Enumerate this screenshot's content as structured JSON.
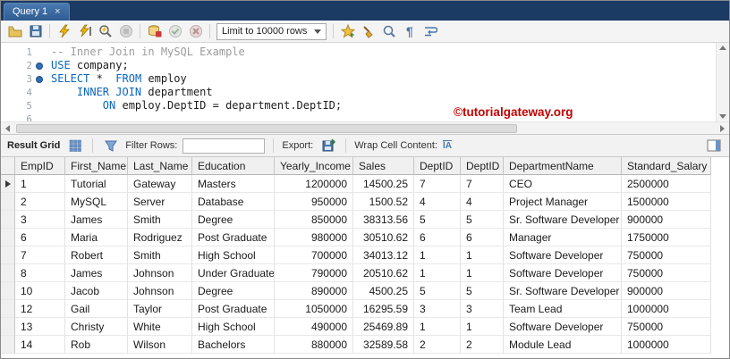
{
  "window": {
    "tab_title": "Query 1",
    "close_glyph": "×"
  },
  "toolbar": {
    "limit_dropdown": "Limit to 10000 rows",
    "pilcrow_glyph": "¶"
  },
  "editor": {
    "lines": [
      {
        "n": "1",
        "dot": false,
        "tokens": [
          {
            "t": "-- Inner Join in MySQL Example",
            "c": "comment"
          }
        ]
      },
      {
        "n": "2",
        "dot": true,
        "tokens": [
          {
            "t": "USE",
            "c": "kw"
          },
          {
            "t": " company;",
            "c": "pl"
          }
        ]
      },
      {
        "n": "3",
        "dot": true,
        "tokens": [
          {
            "t": "SELECT",
            "c": "kw"
          },
          {
            "t": " * ",
            "c": "pl"
          },
          {
            "t": " FROM",
            "c": "kw"
          },
          {
            "t": " employ",
            "c": "pl"
          }
        ]
      },
      {
        "n": "4",
        "dot": false,
        "tokens": [
          {
            "t": "    ",
            "c": "pl"
          },
          {
            "t": "INNER JOIN",
            "c": "kw"
          },
          {
            "t": " department",
            "c": "pl"
          }
        ]
      },
      {
        "n": "5",
        "dot": false,
        "tokens": [
          {
            "t": "        ",
            "c": "pl"
          },
          {
            "t": "ON",
            "c": "kw"
          },
          {
            "t": " employ.DeptID = department.DeptID;",
            "c": "pl"
          }
        ]
      },
      {
        "n": "6",
        "dot": false,
        "tokens": []
      }
    ]
  },
  "watermark": "©tutorialgateway.org",
  "result_toolbar": {
    "result_grid_label": "Result Grid",
    "filter_label": "Filter Rows:",
    "filter_value": "",
    "export_label": "Export:",
    "wrap_label": "Wrap Cell Content:",
    "wrap_icon_text": "ĪA"
  },
  "grid": {
    "columns": [
      "EmpID",
      "First_Name",
      "Last_Name",
      "Education",
      "Yearly_Income",
      "Sales",
      "DeptID",
      "DeptID",
      "DepartmentName",
      "Standard_Salary"
    ],
    "rows": [
      [
        "1",
        "Tutorial",
        "Gateway",
        "Masters",
        "1200000",
        "14500.25",
        "7",
        "7",
        "CEO",
        "2500000"
      ],
      [
        "2",
        "MySQL",
        "Server",
        "Database",
        "950000",
        "1500.52",
        "4",
        "4",
        "Project Manager",
        "1500000"
      ],
      [
        "3",
        "James",
        "Smith",
        "Degree",
        "850000",
        "38313.56",
        "5",
        "5",
        "Sr. Software Developer",
        "900000"
      ],
      [
        "6",
        "Maria",
        "Rodriguez",
        "Post Graduate",
        "980000",
        "30510.62",
        "6",
        "6",
        "Manager",
        "1750000"
      ],
      [
        "7",
        "Robert",
        "Smith",
        "High School",
        "700000",
        "34013.12",
        "1",
        "1",
        "Software Developer",
        "750000"
      ],
      [
        "8",
        "James",
        "Johnson",
        "Under Graduate",
        "790000",
        "20510.62",
        "1",
        "1",
        "Software Developer",
        "750000"
      ],
      [
        "10",
        "Jacob",
        "Johnson",
        "Degree",
        "890000",
        "4500.25",
        "5",
        "5",
        "Sr. Software Developer",
        "900000"
      ],
      [
        "12",
        "Gail",
        "Taylor",
        "Post Graduate",
        "1050000",
        "16295.59",
        "3",
        "3",
        "Team Lead",
        "1000000"
      ],
      [
        "13",
        "Christy",
        "White",
        "High School",
        "490000",
        "25469.89",
        "1",
        "1",
        "Software Developer",
        "750000"
      ],
      [
        "14",
        "Rob",
        "Wilson",
        "Bachelors",
        "880000",
        "32589.58",
        "2",
        "2",
        "Module Lead",
        "1000000"
      ]
    ]
  }
}
